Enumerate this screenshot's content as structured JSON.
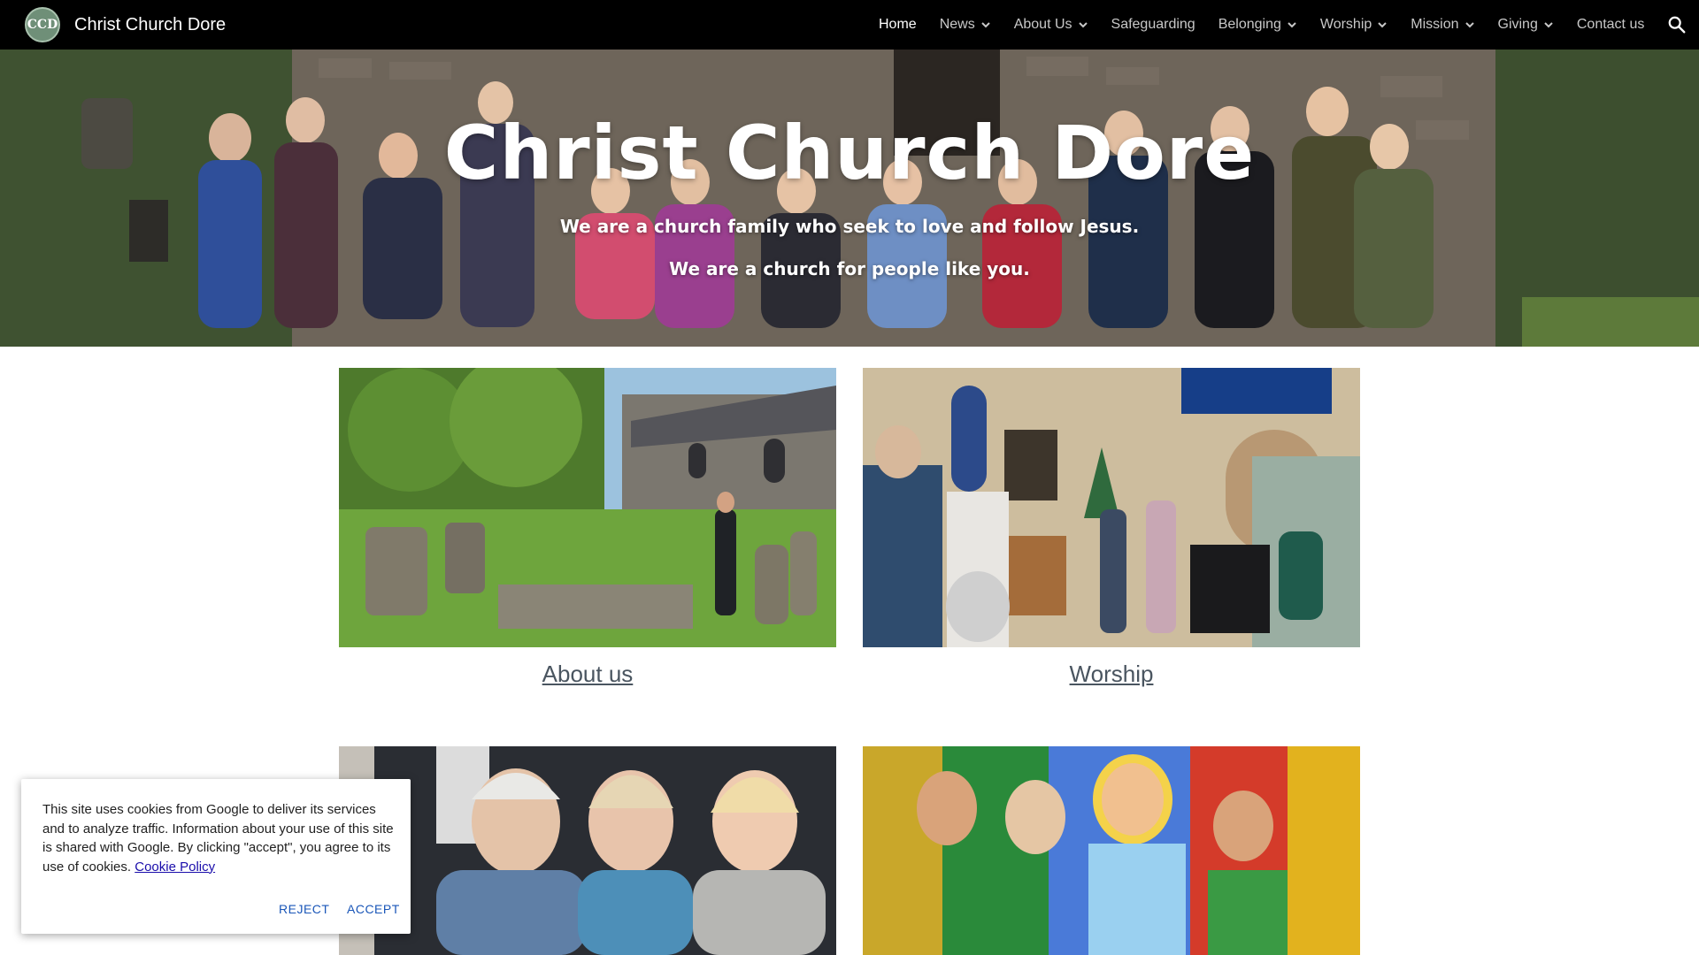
{
  "header": {
    "logo_text": "CCD",
    "site_name": "Christ Church Dore",
    "nav": [
      {
        "label": "Home",
        "active": true,
        "has_dropdown": false
      },
      {
        "label": "News",
        "active": false,
        "has_dropdown": true
      },
      {
        "label": "About Us",
        "active": false,
        "has_dropdown": true
      },
      {
        "label": "Safeguarding",
        "active": false,
        "has_dropdown": false
      },
      {
        "label": "Belonging",
        "active": false,
        "has_dropdown": true
      },
      {
        "label": "Worship",
        "active": false,
        "has_dropdown": true
      },
      {
        "label": "Mission",
        "active": false,
        "has_dropdown": true
      },
      {
        "label": "Giving",
        "active": false,
        "has_dropdown": true
      },
      {
        "label": "Contact us",
        "active": false,
        "has_dropdown": false
      }
    ],
    "search_icon": "search-icon"
  },
  "hero": {
    "title": "Christ Church Dore",
    "line1": "We are a church family who seek to love and follow Jesus.",
    "line2": "We are a church for people like you."
  },
  "cards": [
    {
      "link": "About us"
    },
    {
      "link": "Worship"
    }
  ],
  "cookie": {
    "text": "This site uses cookies from Google to deliver its services and to analyze traffic. Information about your use of this site is shared with Google. By clicking \"accept\", you agree to its use of cookies.",
    "link": "Cookie Policy",
    "reject": "REJECT",
    "accept": "ACCEPT"
  },
  "colors": {
    "topbar": "#000000",
    "link": "#4a5560",
    "cookie_button": "#1a56b8"
  }
}
